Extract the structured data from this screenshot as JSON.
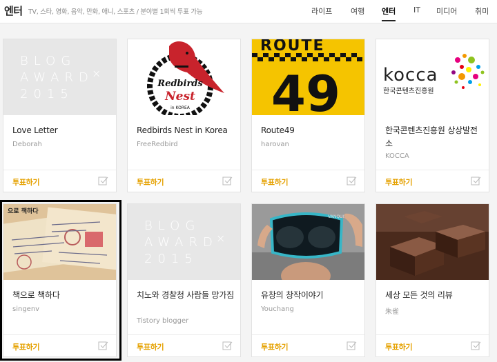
{
  "header": {
    "title": "엔터",
    "subtitle": "TV, 스타, 영화, 음악, 만화, 애니, 스포츠 / 분야별 1회씩 투표 가능",
    "nav": [
      "라이프",
      "여행",
      "엔터",
      "IT",
      "미디어",
      "취미"
    ],
    "active_nav": "엔터"
  },
  "vote_label": "투표하기",
  "award_placeholder": [
    "BLOG",
    "AWARD",
    "2015"
  ],
  "thumb_texts": {
    "redbirds": [
      "Redbirds",
      "Nest",
      "in KOREA"
    ],
    "route": [
      "ROUTE",
      "49"
    ],
    "kocca": [
      "kocca",
      "한국콘텐츠진흥원"
    ],
    "book": "으로 책하다",
    "goggle": "VANQUIST"
  },
  "cards": [
    {
      "title": "Love Letter",
      "author": "Deborah"
    },
    {
      "title": "Redbirds Nest in Korea",
      "author": "FreeRedbird"
    },
    {
      "title": "Route49",
      "author": "harovan"
    },
    {
      "title": "한국콘텐츠진흥원 상상발전소",
      "author": "KOCCA"
    },
    {
      "title": "책으로 책하다",
      "author": "singenv"
    },
    {
      "title": "치노와 경찰청 사람들 망가짐",
      "author": "Tistory blogger"
    },
    {
      "title": "유창의 창작이야기",
      "author": "Youchang"
    },
    {
      "title": "세상 모든 것의 리뷰",
      "author": "朱雀"
    }
  ],
  "colors": {
    "accent": "#e5a100",
    "route_yellow": "#f5c400",
    "kocca_red": "#c8102e"
  }
}
